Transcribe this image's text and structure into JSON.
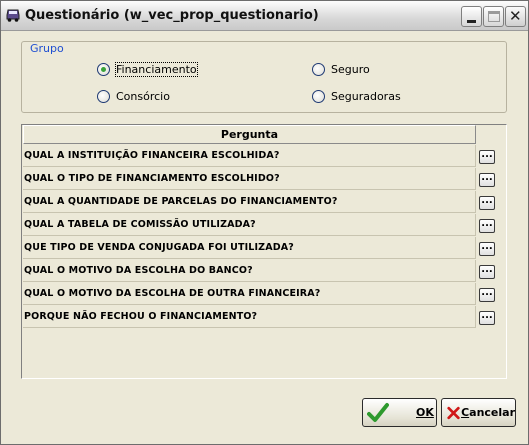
{
  "window": {
    "title": "Questionário  (w_vec_prop_questionario)",
    "app_icon": "car-icon"
  },
  "group": {
    "label": "Grupo",
    "options": [
      {
        "label": "Financiamento",
        "checked": true
      },
      {
        "label": "Seguro",
        "checked": false
      },
      {
        "label": "Consórcio",
        "checked": false
      },
      {
        "label": "Seguradoras",
        "checked": false
      }
    ]
  },
  "table": {
    "header": "Pergunta",
    "rows": [
      "QUAL A INSTITUIÇÃO FINANCEIRA ESCOLHIDA?",
      "QUAL O TIPO DE FINANCIAMENTO ESCOLHIDO?",
      "QUAL A QUANTIDADE DE PARCELAS DO FINANCIAMENTO?",
      "QUAL A TABELA DE COMISSÃO UTILIZADA?",
      "QUE TIPO DE VENDA CONJUGADA FOI UTILIZADA?",
      "QUAL O MOTIVO DA ESCOLHA DO BANCO?",
      "QUAL O MOTIVO DA ESCOLHA DE OUTRA FINANCEIRA?",
      "PORQUE NÃO FECHOU O FINANCIAMENTO?"
    ],
    "row_button_label": "..."
  },
  "buttons": {
    "ok_label": "OK",
    "cancel_label": "Cancelar"
  },
  "colors": {
    "accent": "#1f4fd1",
    "ok_check": "#2e9a2e",
    "cancel_x": "#d01818"
  }
}
